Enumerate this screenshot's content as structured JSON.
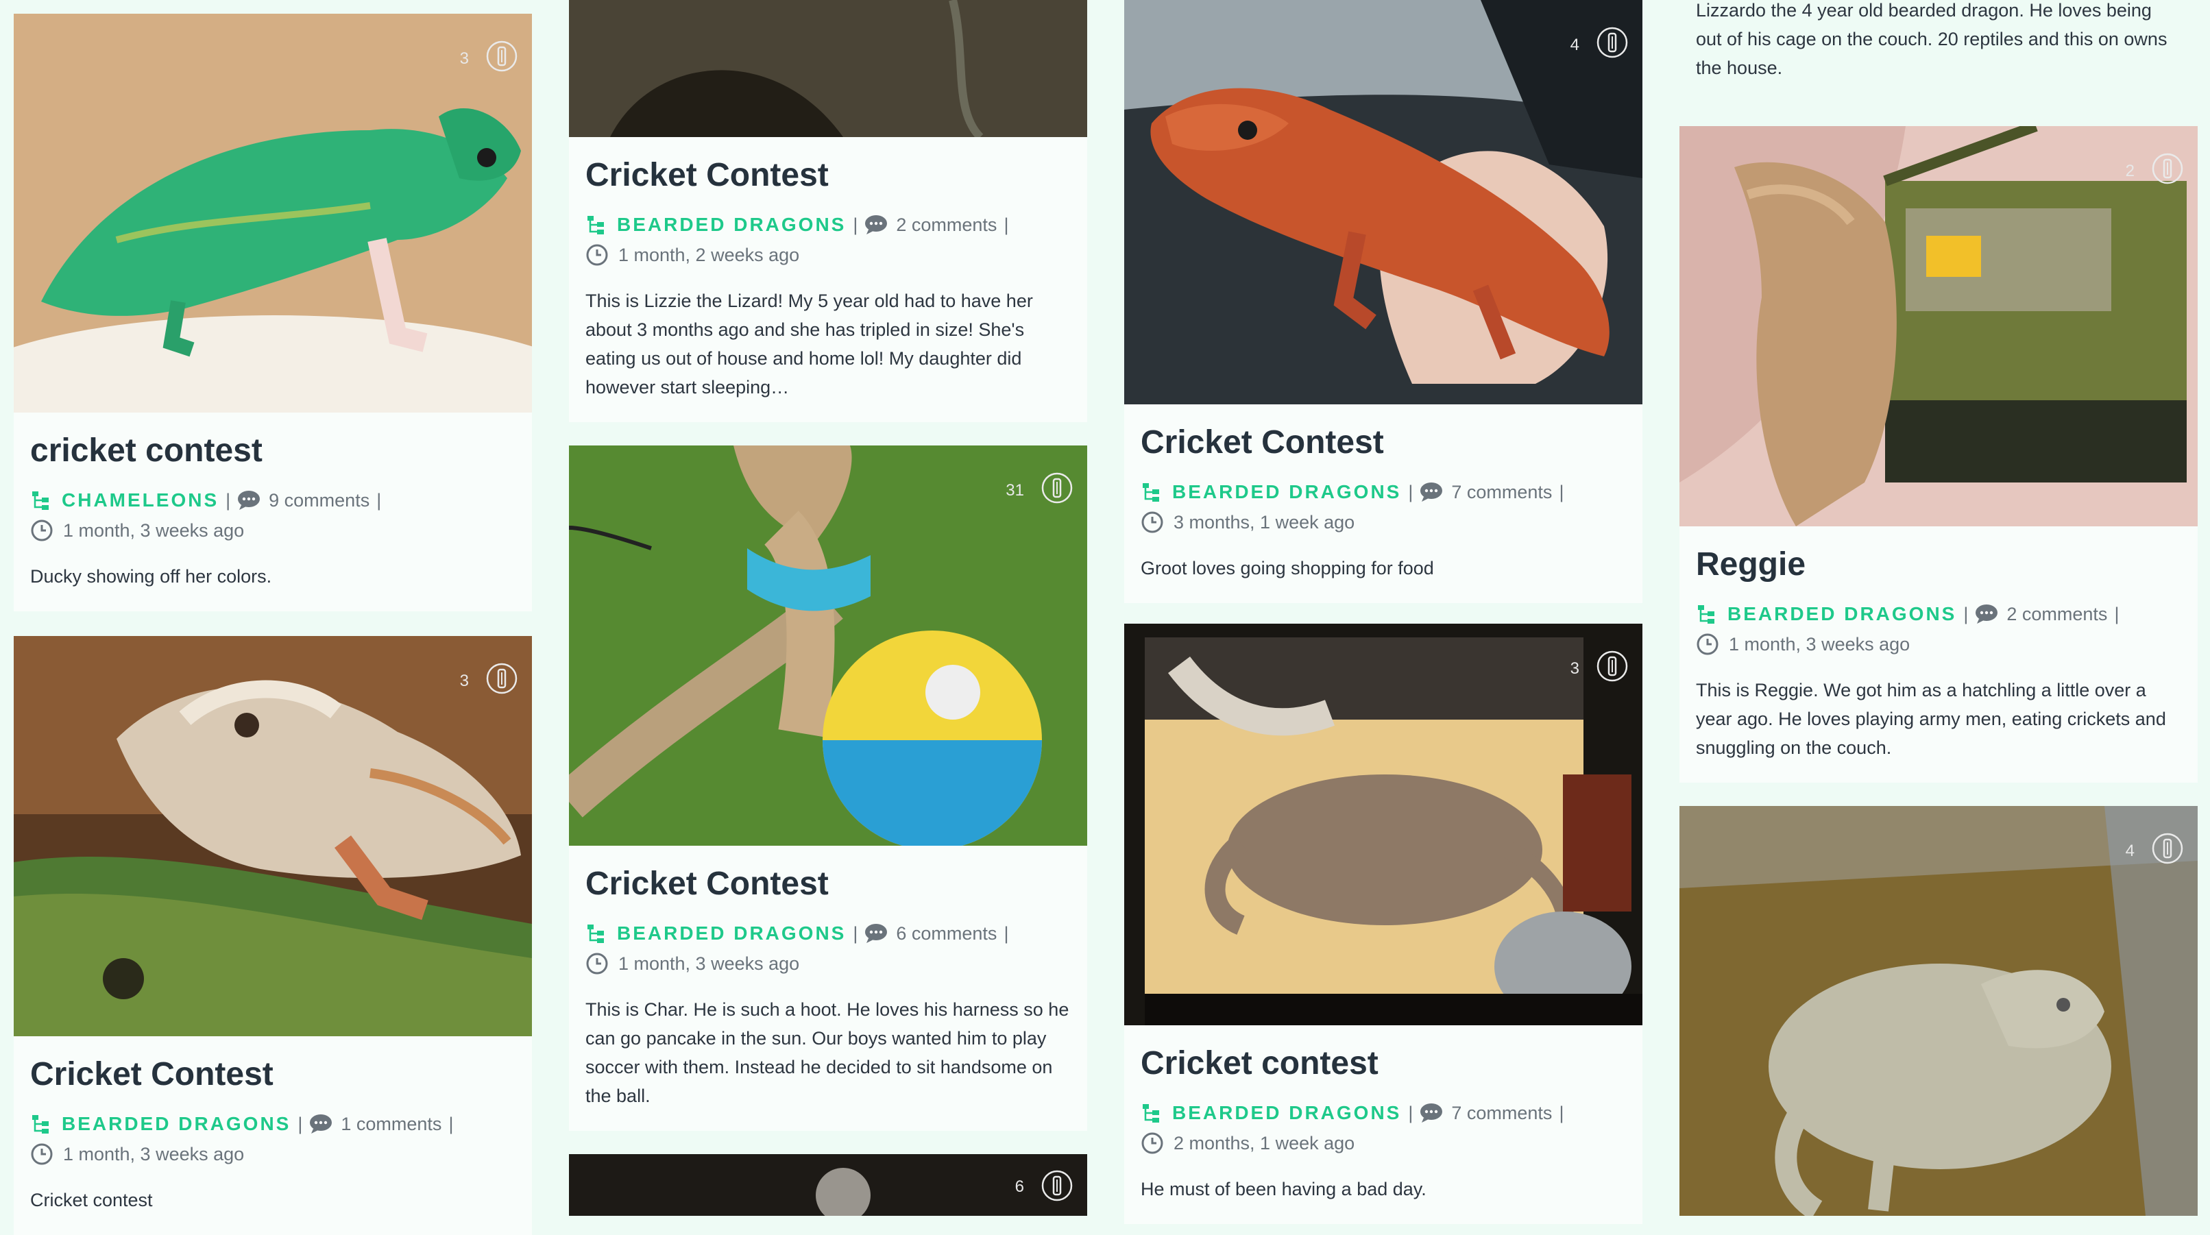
{
  "colors": {
    "background": "#eefbf5",
    "accent": "#1ec98a",
    "text": "#2d3640",
    "muted": "#6a737b"
  },
  "icons": {
    "category": "tree-structure-icon",
    "comments": "speech-bubble-icon",
    "time": "clock-icon",
    "gallery": "gallery-badge-icon"
  },
  "top_text": "Lizzardo the 4 year old bearded dragon. He loves being out of his cage on the couch. 20 reptiles and this on owns the house.",
  "cards": [
    {
      "image_count": "3",
      "title": "cricket contest",
      "category": "CHAMELEONS",
      "comments": "9 comments",
      "comment_sep": "|",
      "time": "1 month, 3 weeks ago",
      "description": "Ducky showing off her colors."
    },
    {
      "image_count": "3",
      "title": "Cricket Contest",
      "category": "BEARDED DRAGONS",
      "comments": "1 comments",
      "comment_sep": "|",
      "time": "1 month, 3 weeks ago",
      "description": "Cricket contest"
    },
    {
      "image_count": "",
      "title": "Cricket Contest",
      "category": "BEARDED DRAGONS",
      "comments": "2 comments",
      "comment_sep": "|",
      "time": "1 month, 2 weeks ago",
      "description": "This is Lizzie the Lizard! My 5 year old had to have her about 3 months ago and she has tripled in size! She's eating us out of house and home lol! My daughter did however start sleeping…"
    },
    {
      "image_count": "31",
      "title": "Cricket Contest",
      "category": "BEARDED DRAGONS",
      "comments": "6 comments",
      "comment_sep": "|",
      "time": "1 month, 3 weeks ago",
      "description": "This is Char. He is such a hoot. He loves his harness so he can go pancake in the sun. Our boys wanted him to play soccer with them. Instead he decided to sit handsome on the ball."
    },
    {
      "image_count": "6"
    },
    {
      "image_count": "4",
      "title": "Cricket Contest",
      "category": "BEARDED DRAGONS",
      "comments": "7 comments",
      "comment_sep": "|",
      "time": "3 months, 1 week ago",
      "description": "Groot loves going shopping for food"
    },
    {
      "image_count": "3",
      "title": "Cricket contest",
      "category": "BEARDED DRAGONS",
      "comments": "7 comments",
      "comment_sep": "|",
      "time": "2 months, 1 week ago",
      "description": "He must of been having a bad day."
    },
    {
      "image_count": "2",
      "title": "Reggie",
      "category": "BEARDED DRAGONS",
      "comments": "2 comments",
      "comment_sep": "|",
      "time": "1 month, 3 weeks ago",
      "description": "This is Reggie. We got him as a hatchling a little over a year ago. He loves playing army men, eating crickets and snuggling on the couch."
    },
    {
      "image_count": "4"
    }
  ]
}
